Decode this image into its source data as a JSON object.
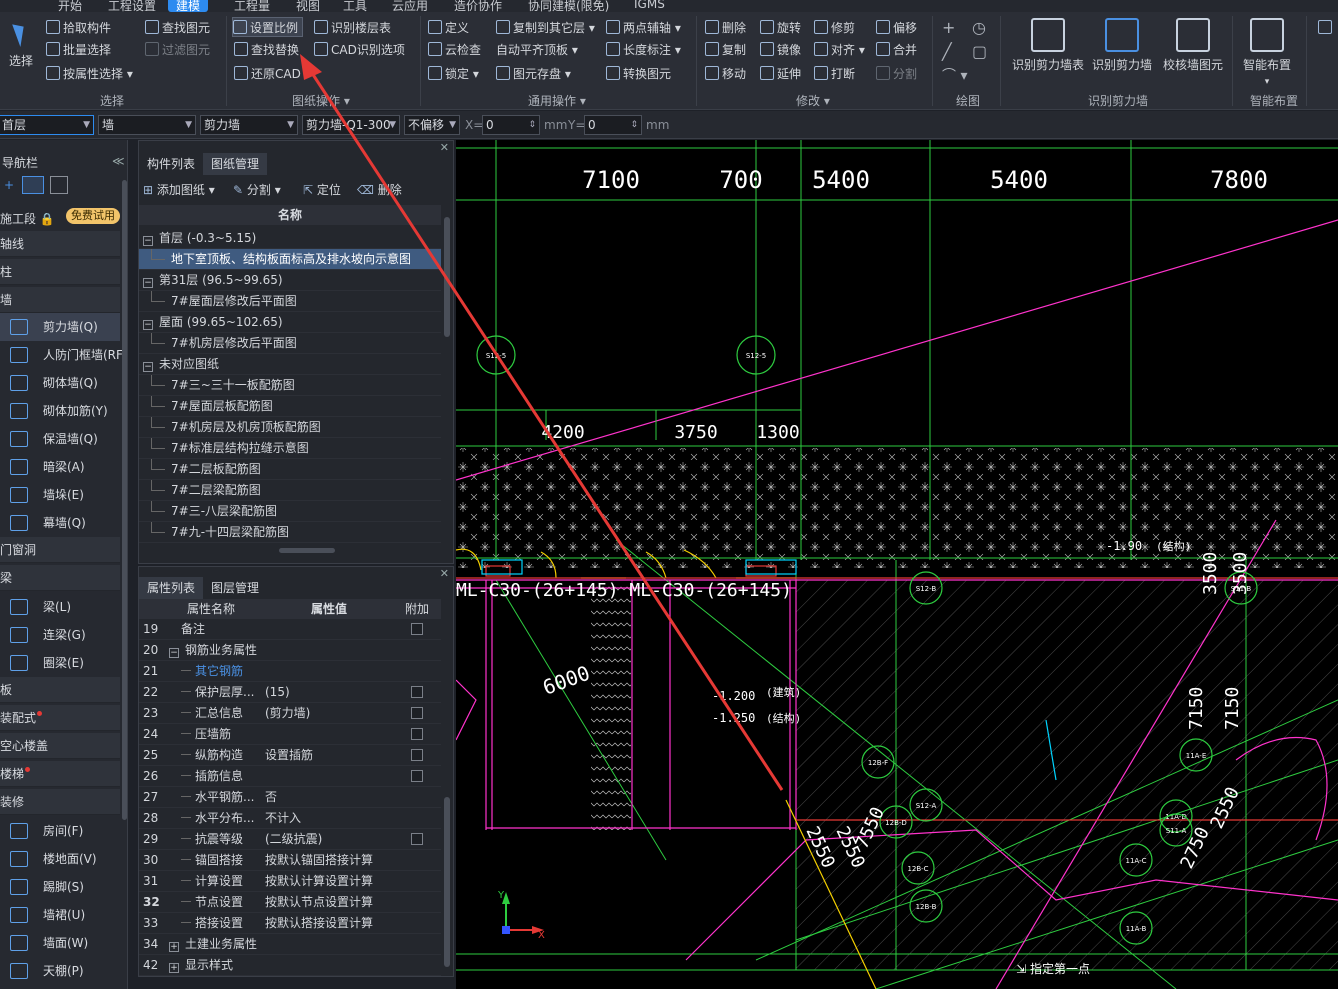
{
  "menu": [
    "开始",
    "工程设置",
    "建模",
    "视图",
    "工程量",
    "工具",
    "云应用",
    "造价协作",
    "协同建模(限免)",
    "IGMS"
  ],
  "menu_active_index": 2,
  "ribbon": {
    "select_group": {
      "big": "选择",
      "items": [
        "拾取构件",
        "批量选择",
        "按属性选择"
      ],
      "items2": [
        "查找图元",
        "过滤图元"
      ],
      "label": "选择"
    },
    "drawing_ops": {
      "items": [
        "设置比例",
        "查找替换",
        "还原CAD",
        "识别楼层表",
        "CAD识别选项"
      ],
      "label": "图纸操作"
    },
    "general_ops": {
      "items": [
        "定义",
        "云检查",
        "锁定",
        "复制到其它层",
        "自动平齐顶板",
        "图元存盘",
        "两点辅轴",
        "长度标注",
        "转换图元"
      ],
      "label": "通用操作"
    },
    "modify": {
      "items": [
        "删除",
        "复制",
        "移动",
        "旋转",
        "镜像",
        "延伸",
        "修剪",
        "对齐",
        "打断",
        "偏移",
        "合并",
        "分割"
      ],
      "label": "修改"
    },
    "draw": {
      "label": "绘图"
    },
    "recognize_wall": {
      "items": [
        "识别剪力墙表",
        "识别剪力墙",
        "校核墙图元"
      ],
      "label": "识别剪力墙"
    },
    "smart": {
      "items": [
        "智能布置"
      ],
      "label": "智能布置"
    }
  },
  "toolbar": {
    "floor": "首层",
    "type": "墙",
    "subtype": "剪力墙",
    "component": "剪力墙-Q1-300",
    "offset": "不偏移",
    "x_label": "X=",
    "x_value": "0",
    "mm1": "mm",
    "y_label": "Y=",
    "y_value": "0",
    "mm2": "mm"
  },
  "nav": {
    "title": "导航栏",
    "construction_stage": "施工段",
    "trial_badge": "免费试用",
    "categories": [
      {
        "label": "轴线"
      },
      {
        "label": "柱"
      },
      {
        "label": "墙"
      }
    ],
    "wall_items": [
      "剪力墙(Q)",
      "人防门框墙(RF",
      "砌体墙(Q)",
      "砌体加筋(Y)",
      "保温墙(Q)",
      "暗梁(A)",
      "墙垛(E)",
      "幕墙(Q)"
    ],
    "door_window": "门窗洞",
    "beam": "梁",
    "beam_items": [
      "梁(L)",
      "连梁(G)",
      "圈梁(E)"
    ],
    "slab": "板",
    "prefab": "装配式",
    "hollow_slab": "空心楼盖",
    "stairs": "楼梯",
    "decoration": "装修",
    "decoration_items": [
      "房间(F)",
      "楼地面(V)",
      "踢脚(S)",
      "墙裙(U)",
      "墙面(W)",
      "天棚(P)"
    ]
  },
  "component_panel": {
    "tabs": [
      "构件列表",
      "图纸管理"
    ],
    "tools": [
      "添加图纸",
      "分割",
      "定位",
      "删除"
    ],
    "column_name": "名称",
    "tree": [
      {
        "level": 0,
        "label": "首层 (-0.3~5.15)",
        "box": "−"
      },
      {
        "level": 1,
        "label": "地下室顶板、结构板面标高及排水坡向示意图",
        "selected": true
      },
      {
        "level": 0,
        "label": "第31层 (96.5~99.65)",
        "box": "−"
      },
      {
        "level": 1,
        "label": "7#屋面层修改后平面图"
      },
      {
        "level": 0,
        "label": "屋面 (99.65~102.65)",
        "box": "−"
      },
      {
        "level": 1,
        "label": "7#机房层修改后平面图"
      },
      {
        "level": 0,
        "label": "未对应图纸",
        "box": "−"
      },
      {
        "level": 1,
        "label": "7#三~三十一板配筋图"
      },
      {
        "level": 1,
        "label": "7#屋面层板配筋图"
      },
      {
        "level": 1,
        "label": "7#机房层及机房顶板配筋图"
      },
      {
        "level": 1,
        "label": "7#标准层结构拉缝示意图"
      },
      {
        "level": 1,
        "label": "7#二层板配筋图"
      },
      {
        "level": 1,
        "label": "7#二层梁配筋图"
      },
      {
        "level": 1,
        "label": "7#三-八层梁配筋图"
      },
      {
        "level": 1,
        "label": "7#九-十四层梁配筋图"
      }
    ]
  },
  "property_panel": {
    "tabs": [
      "属性列表",
      "图层管理"
    ],
    "headers": [
      "属性名称",
      "属性值",
      "附加"
    ],
    "rows": [
      {
        "n": "19",
        "name": "备注",
        "value": "",
        "chk": true
      },
      {
        "n": "20",
        "name": "钢筋业务属性",
        "value": "",
        "box": "−"
      },
      {
        "n": "21",
        "name": "其它钢筋",
        "value": "",
        "blue": true
      },
      {
        "n": "22",
        "name": "保护层厚...",
        "value": "(15)",
        "chk": true
      },
      {
        "n": "23",
        "name": "汇总信息",
        "value": "(剪力墙)",
        "chk": true
      },
      {
        "n": "24",
        "name": "压墙筋",
        "value": "",
        "chk": true
      },
      {
        "n": "25",
        "name": "纵筋构造",
        "value": "设置插筋",
        "chk": true
      },
      {
        "n": "26",
        "name": "插筋信息",
        "value": "",
        "chk": true
      },
      {
        "n": "27",
        "name": "水平钢筋...",
        "value": "否"
      },
      {
        "n": "28",
        "name": "水平分布...",
        "value": "不计入"
      },
      {
        "n": "29",
        "name": "抗震等级",
        "value": "(二级抗震)",
        "chk": true
      },
      {
        "n": "30",
        "name": "锚固搭接",
        "value": "按默认锚固搭接计算"
      },
      {
        "n": "31",
        "name": "计算设置",
        "value": "按默认计算设置计算"
      },
      {
        "n": "32",
        "name": "节点设置",
        "value": "按默认节点设置计算",
        "bold": true
      },
      {
        "n": "33",
        "name": "搭接设置",
        "value": "按默认搭接设置计算"
      },
      {
        "n": "34",
        "name": "土建业务属性",
        "value": "",
        "box": "+"
      },
      {
        "n": "42",
        "name": "显示样式",
        "value": "",
        "box": "+"
      }
    ]
  },
  "canvas": {
    "top_dimensions": [
      "7100",
      "700",
      "5400",
      "5400",
      "7800"
    ],
    "mid_dimensions": [
      "4200",
      "3750",
      "1300"
    ],
    "markers": [
      "S12-5",
      "S12-5",
      "S12-B",
      "S11-B",
      "12B-F",
      "S12-A",
      "12B-D",
      "12B-C",
      "12B-B",
      "11A-E",
      "11A-D",
      "S11-A",
      "11A-C",
      "11A-B"
    ],
    "labels": [
      "-1.90",
      "(结构)",
      "-1.200",
      "(建筑)",
      "-1.250",
      "(结构)",
      "6000",
      "7150",
      "7150",
      "2550",
      "2550",
      "7550",
      "2750",
      "2550",
      "3500",
      "3500"
    ],
    "beam_text": "ML-C30-(26+145) ML-C30-(26+145)",
    "status_hint": "指定第一点",
    "annotation_arrow_color": "#e53935"
  }
}
